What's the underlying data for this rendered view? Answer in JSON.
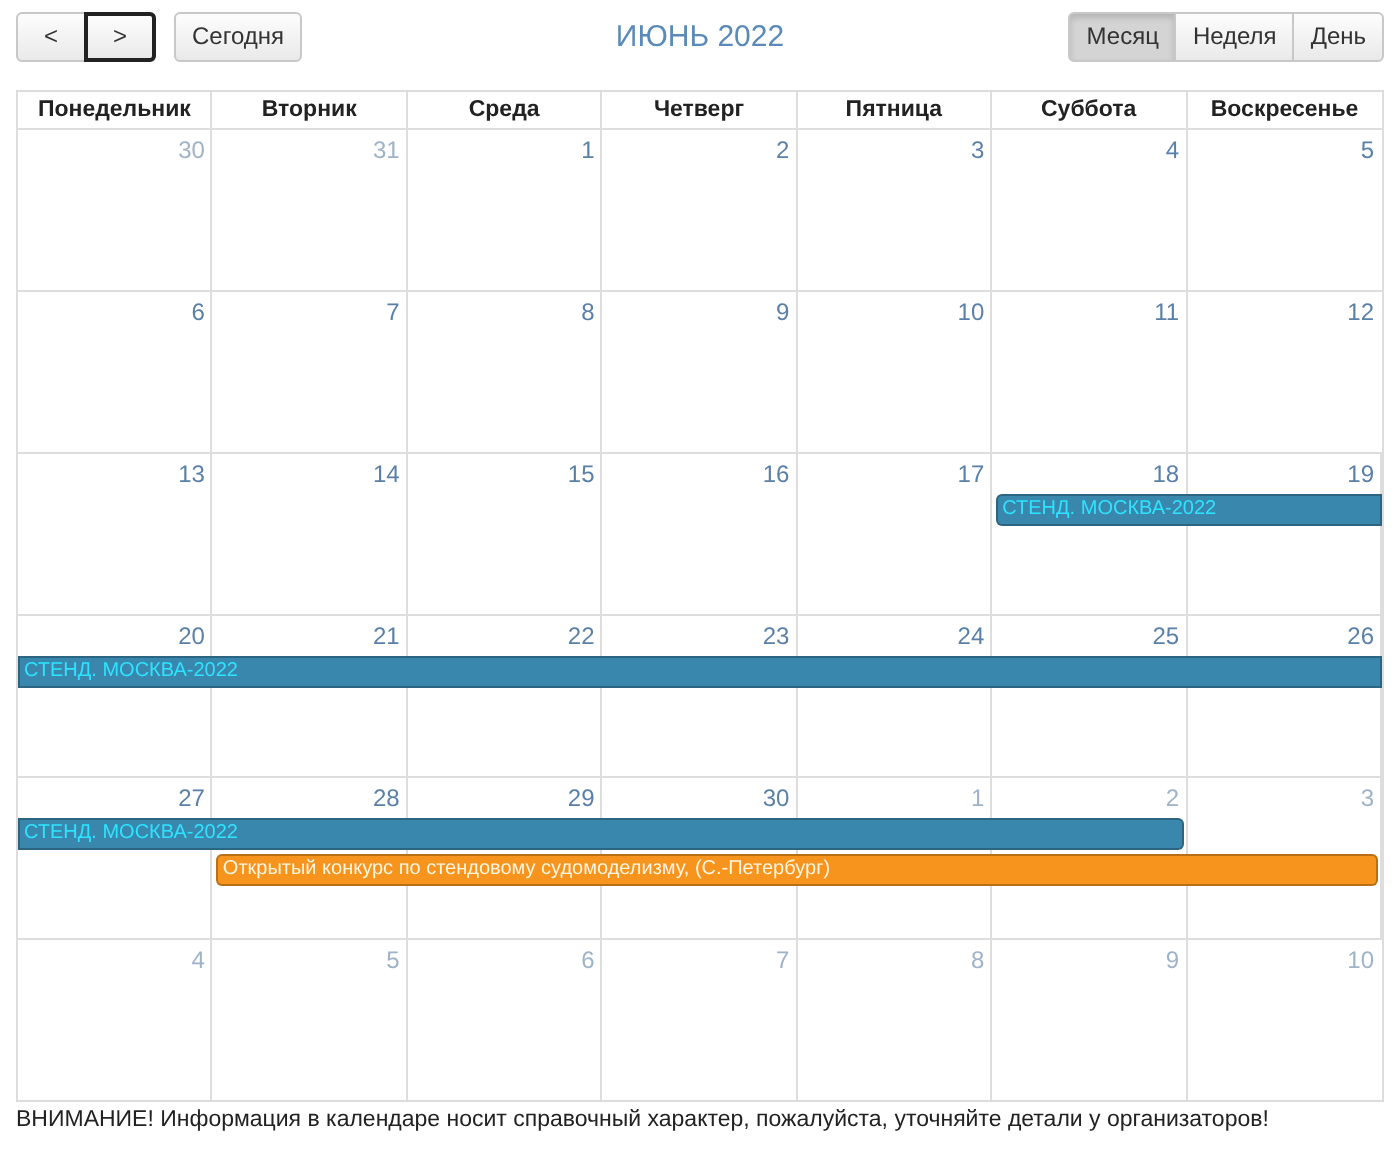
{
  "toolbar": {
    "prev": "<",
    "next": ">",
    "today": "Сегодня",
    "title": "ИЮНЬ 2022",
    "views": [
      {
        "label": "Месяц",
        "selected": true
      },
      {
        "label": "Неделя",
        "selected": false
      },
      {
        "label": "День",
        "selected": false
      }
    ]
  },
  "weekdays": [
    "Понедельник",
    "Вторник",
    "Среда",
    "Четверг",
    "Пятница",
    "Суббота",
    "Воскресенье"
  ],
  "weeks": [
    {
      "days": [
        {
          "num": "30",
          "other_month": true
        },
        {
          "num": "31",
          "other_month": true
        },
        {
          "num": "1",
          "other_month": false
        },
        {
          "num": "2",
          "other_month": false
        },
        {
          "num": "3",
          "other_month": false
        },
        {
          "num": "4",
          "other_month": false
        },
        {
          "num": "5",
          "other_month": false
        }
      ]
    },
    {
      "days": [
        {
          "num": "6",
          "other_month": false
        },
        {
          "num": "7",
          "other_month": false
        },
        {
          "num": "8",
          "other_month": false
        },
        {
          "num": "9",
          "other_month": false
        },
        {
          "num": "10",
          "other_month": false
        },
        {
          "num": "11",
          "other_month": false
        },
        {
          "num": "12",
          "other_month": false
        }
      ]
    },
    {
      "days": [
        {
          "num": "13",
          "other_month": false
        },
        {
          "num": "14",
          "other_month": false
        },
        {
          "num": "15",
          "other_month": false
        },
        {
          "num": "16",
          "other_month": false
        },
        {
          "num": "17",
          "other_month": false
        },
        {
          "num": "18",
          "other_month": false
        },
        {
          "num": "19",
          "other_month": false
        }
      ],
      "events": [
        {
          "title": "СТЕНД. МОСКВА-2022",
          "color": "#3a87ad"
        }
      ]
    },
    {
      "days": [
        {
          "num": "20",
          "other_month": false
        },
        {
          "num": "21",
          "other_month": false
        },
        {
          "num": "22",
          "other_month": false
        },
        {
          "num": "23",
          "other_month": false
        },
        {
          "num": "24",
          "other_month": false
        },
        {
          "num": "25",
          "other_month": false
        },
        {
          "num": "26",
          "other_month": false
        }
      ],
      "events": [
        {
          "title": "СТЕНД. МОСКВА-2022",
          "color": "#3a87ad"
        }
      ]
    },
    {
      "days": [
        {
          "num": "27",
          "other_month": false
        },
        {
          "num": "28",
          "other_month": false
        },
        {
          "num": "29",
          "other_month": false
        },
        {
          "num": "30",
          "other_month": false
        },
        {
          "num": "1",
          "other_month": true
        },
        {
          "num": "2",
          "other_month": true
        },
        {
          "num": "3",
          "other_month": true
        }
      ],
      "events": [
        {
          "title": "СТЕНД. МОСКВА-2022",
          "color": "#3a87ad"
        },
        {
          "title": "Открытый конкурс по стендовому судомоделизму, (С.-Петербург)",
          "color": "#f7941d"
        }
      ]
    },
    {
      "days": [
        {
          "num": "4",
          "other_month": true
        },
        {
          "num": "5",
          "other_month": true
        },
        {
          "num": "6",
          "other_month": true
        },
        {
          "num": "7",
          "other_month": true
        },
        {
          "num": "8",
          "other_month": true
        },
        {
          "num": "9",
          "other_month": true
        },
        {
          "num": "10",
          "other_month": true
        }
      ]
    }
  ],
  "notice": "ВНИМАНИЕ! Информация в календаре носит справочный характер, пожалуйста, уточняйте детали у организаторов!"
}
